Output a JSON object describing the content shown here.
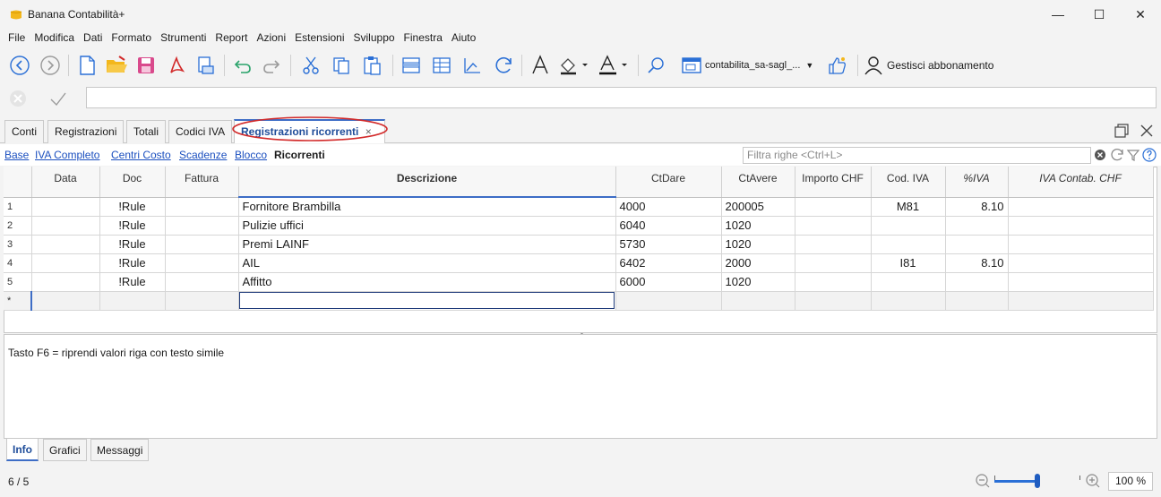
{
  "window": {
    "title": "Banana Contabilità+",
    "minimize": "—",
    "maximize": "☐",
    "close": "✕"
  },
  "menu": [
    "File",
    "Modifica",
    "Dati",
    "Formato",
    "Strumenti",
    "Report",
    "Azioni",
    "Estensioni",
    "Sviluppo",
    "Finestra",
    "Aiuto"
  ],
  "toolbar": {
    "file_selector": "contabilita_sa-sagl_...",
    "subscription": "Gestisci abbonamento"
  },
  "tabs": [
    "Conti",
    "Registrazioni",
    "Totali",
    "Codici IVA",
    "Registrazioni ricorrenti"
  ],
  "tab_close": "×",
  "views": {
    "links": [
      "Base",
      "IVA Completo",
      "Centri Costo",
      "Scadenze",
      "Blocco"
    ],
    "active": "Ricorrenti"
  },
  "filter_placeholder": "Filtra righe <Ctrl+L>",
  "table": {
    "headers": [
      "",
      "Data",
      "Doc",
      "Fattura",
      "Descrizione",
      "CtDare",
      "CtAvere",
      "Importo CHF",
      "Cod. IVA",
      "%IVA",
      "IVA Contab. CHF"
    ],
    "rows": [
      {
        "num": "1",
        "data": "",
        "doc": "!Rule",
        "fattura": "",
        "descrizione": "Fornitore Brambilla",
        "ctdare": "4000",
        "ctavere": "200005",
        "importo": "",
        "codiva": "M81",
        "piva": "8.10",
        "ivacontab": ""
      },
      {
        "num": "2",
        "data": "",
        "doc": "!Rule",
        "fattura": "",
        "descrizione": "Pulizie uffici",
        "ctdare": "6040",
        "ctavere": "1020",
        "importo": "",
        "codiva": "",
        "piva": "",
        "ivacontab": ""
      },
      {
        "num": "3",
        "data": "",
        "doc": "!Rule",
        "fattura": "",
        "descrizione": "Premi LAINF",
        "ctdare": "5730",
        "ctavere": "1020",
        "importo": "",
        "codiva": "",
        "piva": "",
        "ivacontab": ""
      },
      {
        "num": "4",
        "data": "",
        "doc": "!Rule",
        "fattura": "",
        "descrizione": "AIL",
        "ctdare": "6402",
        "ctavere": "2000",
        "importo": "",
        "codiva": "I81",
        "piva": "8.10",
        "ivacontab": ""
      },
      {
        "num": "5",
        "data": "",
        "doc": "!Rule",
        "fattura": "",
        "descrizione": "Affitto",
        "ctdare": "6000",
        "ctavere": "1020",
        "importo": "",
        "codiva": "",
        "piva": "",
        "ivacontab": ""
      }
    ],
    "new_row_marker": "*"
  },
  "info_text": "Tasto F6 = riprendi valori riga con testo simile",
  "bottom_tabs": [
    "Info",
    "Grafici",
    "Messaggi"
  ],
  "status": {
    "row_position": "6 / 5",
    "zoom": "100 %",
    "zoom_level": 0.5
  },
  "colors": {
    "accent": "#1f4d9a",
    "link": "#1b4fbf",
    "highlight_ellipse": "#d22a2a",
    "logo": "#f3b71c"
  }
}
